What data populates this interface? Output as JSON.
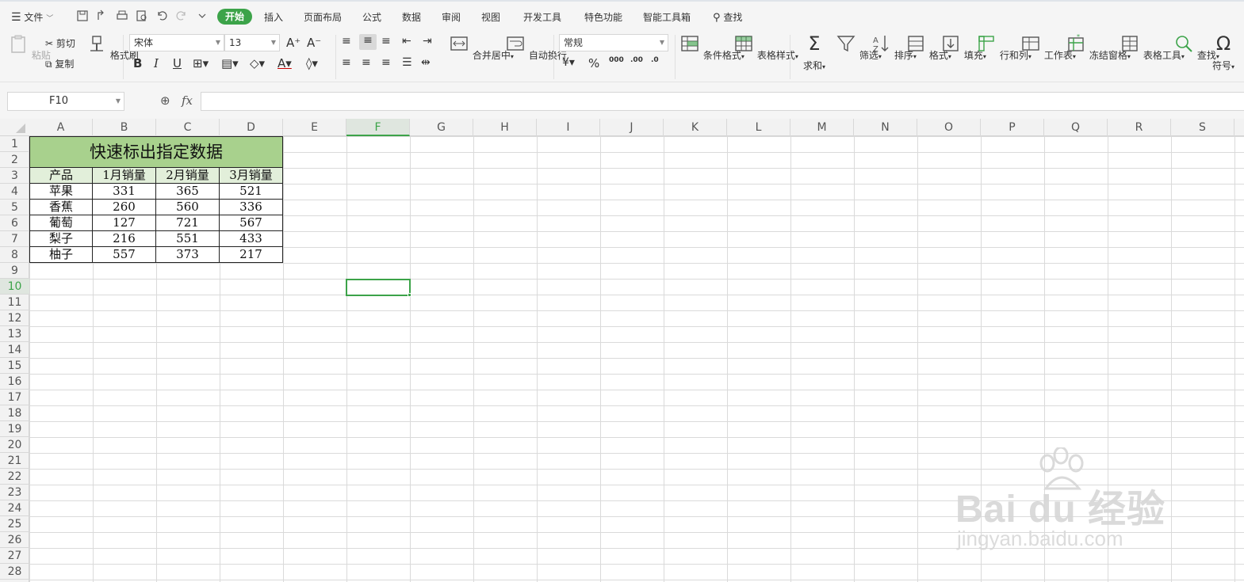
{
  "menu": {
    "file": "文件",
    "tabs": [
      "开始",
      "插入",
      "页面布局",
      "公式",
      "数据",
      "审阅",
      "视图",
      "开发工具",
      "特色功能",
      "智能工具箱"
    ],
    "active_tab": "开始",
    "search": "查找"
  },
  "ribbon": {
    "paste": "粘贴",
    "cut": "剪切",
    "copy": "复制",
    "format_painter": "格式刷",
    "font_name": "宋体",
    "font_size": "13",
    "merge_center": "合并居中",
    "wrap_text": "自动换行",
    "number_format": "常规",
    "conditional_format": "条件格式",
    "table_style": "表格样式",
    "sum": "求和",
    "filter": "筛选",
    "sort": "排序",
    "format": "格式",
    "fill": "填充",
    "row_col": "行和列",
    "worksheet": "工作表",
    "freeze": "冻结窗格",
    "table_tools": "表格工具",
    "find": "查找",
    "symbol": "符号"
  },
  "formula_bar": {
    "name_box": "F10",
    "fx": "fx",
    "value": ""
  },
  "sheet": {
    "columns": [
      "A",
      "B",
      "C",
      "D",
      "E",
      "F",
      "G",
      "H",
      "I",
      "J",
      "K",
      "L",
      "M",
      "N",
      "O",
      "P",
      "Q",
      "R",
      "S"
    ],
    "rows": [
      "1",
      "2",
      "3",
      "4",
      "5",
      "6",
      "7",
      "8",
      "9",
      "10",
      "11",
      "12",
      "13",
      "14",
      "15",
      "16",
      "17",
      "18",
      "19",
      "20",
      "21",
      "22",
      "23",
      "24",
      "25",
      "26",
      "27",
      "28"
    ],
    "active_column": "F",
    "active_row": "10",
    "title": "快速标出指定数据",
    "headers": [
      "产品",
      "1月销量",
      "2月销量",
      "3月销量"
    ],
    "data": [
      [
        "苹果",
        "331",
        "365",
        "521"
      ],
      [
        "香蕉",
        "260",
        "560",
        "336"
      ],
      [
        "葡萄",
        "127",
        "721",
        "567"
      ],
      [
        "梨子",
        "216",
        "551",
        "433"
      ],
      [
        "柚子",
        "557",
        "373",
        "217"
      ]
    ]
  },
  "watermark": {
    "brand": "Bai du 经验",
    "url": "jingyan.baidu.com"
  },
  "colors": {
    "accent": "#3ca349",
    "title_fill": "#a8d18d",
    "header_fill": "#e2efda"
  }
}
